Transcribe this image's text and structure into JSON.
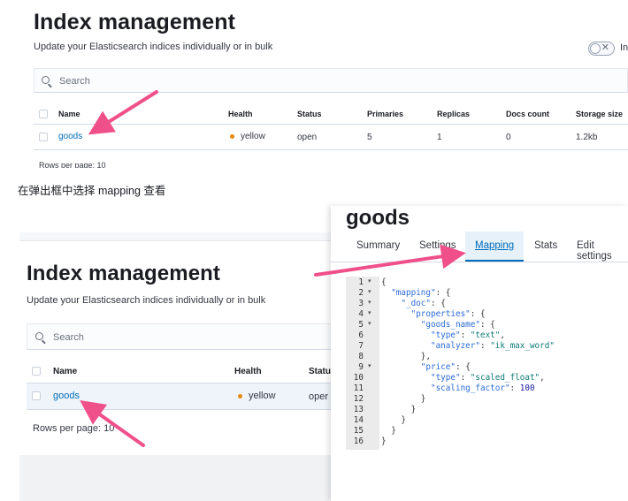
{
  "top": {
    "title": "Index management",
    "subtitle": "Update your Elasticsearch indices individually or in bulk",
    "toggle_label": "In",
    "search_placeholder": "Search",
    "columns": [
      "Name",
      "Health",
      "Status",
      "Primaries",
      "Replicas",
      "Docs count",
      "Storage size"
    ],
    "row": {
      "name": "goods",
      "health": "yellow",
      "status": "open",
      "primaries": "5",
      "replicas": "1",
      "docs_count": "0",
      "storage_size": "1.2kb"
    },
    "rows_per_page": "Rows per page: 10"
  },
  "caption": "在弹出框中选择 mapping 查看",
  "bottom_left": {
    "title": "Index management",
    "subtitle": "Update your Elasticsearch indices individually or in bulk",
    "search_placeholder": "Search",
    "columns": [
      "Name",
      "Health",
      "Statu"
    ],
    "row": {
      "name": "goods",
      "health": "yellow",
      "status": "oper"
    },
    "rows_per_page": "Rows per page: 10"
  },
  "flyout": {
    "title": "goods",
    "tabs": [
      "Summary",
      "Settings",
      "Mapping",
      "Stats",
      "Edit settings"
    ],
    "active_tab": "Mapping",
    "code_lines": [
      "{",
      "  \"mapping\": {",
      "    \"_doc\": {",
      "      \"properties\": {",
      "        \"goods_name\": {",
      "          \"type\": \"text\",",
      "          \"analyzer\": \"ik_max_word\"",
      "        },",
      "        \"price\": {",
      "          \"type\": \"scaled_float\",",
      "          \"scaling_factor\": 100",
      "        }",
      "      }",
      "    }",
      "  }",
      "}"
    ],
    "line_numbers": [
      "1",
      "2",
      "3",
      "4",
      "5",
      "6",
      "7",
      "8",
      "9",
      "10",
      "11",
      "12",
      "13",
      "14",
      "15",
      "16"
    ],
    "fold_lines": [
      1,
      2,
      3,
      4,
      5,
      9
    ]
  },
  "colors": {
    "arrow": "#f0508a",
    "link": "#006bb8",
    "health_yellow": "#e8890b",
    "tab_active_bg": "#e6f1fa"
  }
}
